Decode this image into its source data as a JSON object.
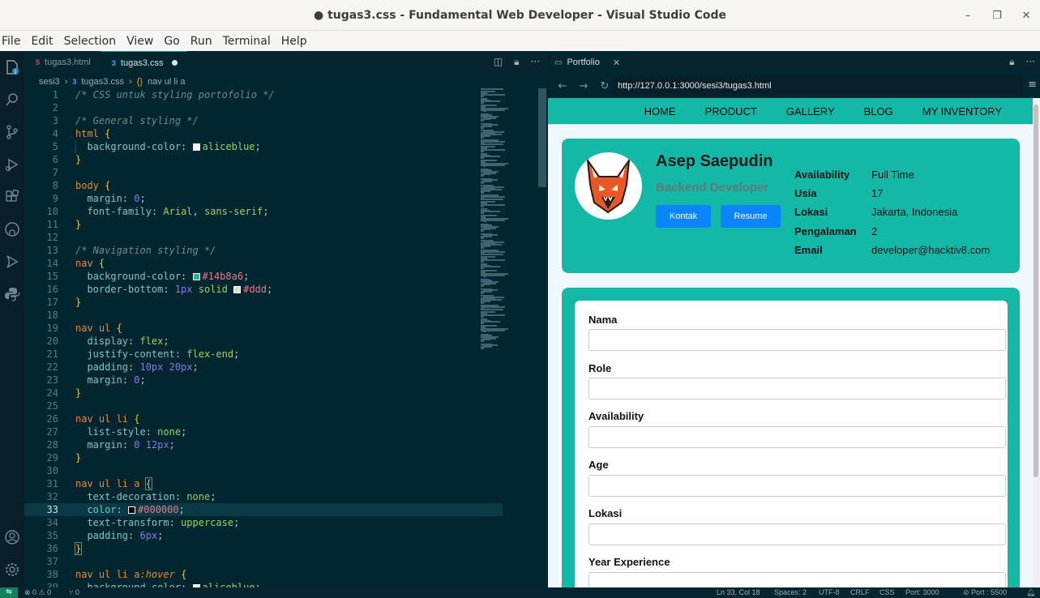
{
  "window": {
    "title": "● tugas3.css - Fundamental Web Developer - Visual Studio Code",
    "controls": [
      "–",
      "❐",
      "✕"
    ]
  },
  "menu": [
    "File",
    "Edit",
    "Selection",
    "View",
    "Go",
    "Run",
    "Terminal",
    "Help"
  ],
  "activity": {
    "explorer_badge": "1"
  },
  "editor": {
    "tabs": [
      {
        "label": "tugas3.html",
        "icon": "html-file-icon",
        "active": false
      },
      {
        "label": "tugas3.css",
        "icon": "css-file-icon",
        "active": true,
        "modified": true
      }
    ],
    "breadcrumb": [
      "sesi3",
      "tugas3.css",
      "nav ul li a"
    ],
    "current_line": 33
  },
  "browser": {
    "tab_label": "Portfolio",
    "url": "http://127.0.0.1:3000/sesi3/tugas3.html",
    "nav_links": [
      "HOME",
      "PRODUCT",
      "GALLERY",
      "BLOG",
      "MY INVENTORY"
    ],
    "profile": {
      "name": "Asep Saepudin",
      "role": "Backend Developer",
      "buttons": [
        "Kontak",
        "Resume"
      ],
      "info": [
        {
          "key": "Availability",
          "value": "Full Time"
        },
        {
          "key": "Usia",
          "value": "17"
        },
        {
          "key": "Lokasi",
          "value": "Jakarta, Indonesia"
        },
        {
          "key": "Pengalaman",
          "value": "2"
        },
        {
          "key": "Email",
          "value": "developer@hacktiv8.com"
        }
      ]
    },
    "form_fields": [
      "Nama",
      "Role",
      "Availability",
      "Age",
      "Lokasi",
      "Year Experience"
    ]
  },
  "statusbar": {
    "problems": "⊗ 0 ⚠ 0",
    "ports_left": "⑂ 0",
    "position": "Ln 33, Col 18",
    "spaces": "Spaces: 2",
    "encoding": "UTF-8",
    "eol": "CRLF",
    "language": "CSS",
    "port_3000": "Port: 3000",
    "port_5500": "⊘ Port : 5500"
  },
  "colors": {
    "accent": "#14b8a6",
    "button": "#0a84ff",
    "editor_bg": "#02262f"
  }
}
